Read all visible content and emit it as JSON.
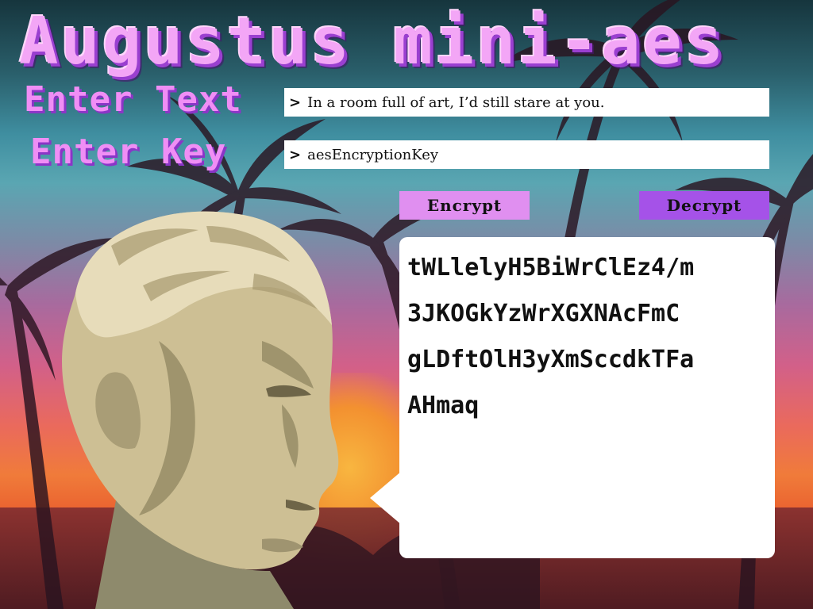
{
  "app": {
    "title": "Augustus mini-aes"
  },
  "form": {
    "text_label": "Enter Text",
    "key_label": "Enter Key",
    "prompt_symbol": ">",
    "text_value": "In a room full of art, I’d still stare at you.",
    "key_value": "aesEncryptionKey"
  },
  "actions": {
    "encrypt_label": "Encrypt",
    "decrypt_label": "Decrypt"
  },
  "output": {
    "lines": [
      "tWLlelyH5BiWrClEz4/m",
      "3JKOGkYzWrXGXNAcFmC",
      "gLDftOlH3yXmSccdkTFa",
      "AHmaq"
    ]
  },
  "colors": {
    "title_fill": "#f3a6f6",
    "title_shadow": "#9a3fd0",
    "encrypt_bg": "#e08ff0",
    "decrypt_bg": "#a552e8"
  },
  "icons": {
    "background": "palm-trees-sunset-illustration",
    "bust": "augustus-bust-illustration"
  }
}
